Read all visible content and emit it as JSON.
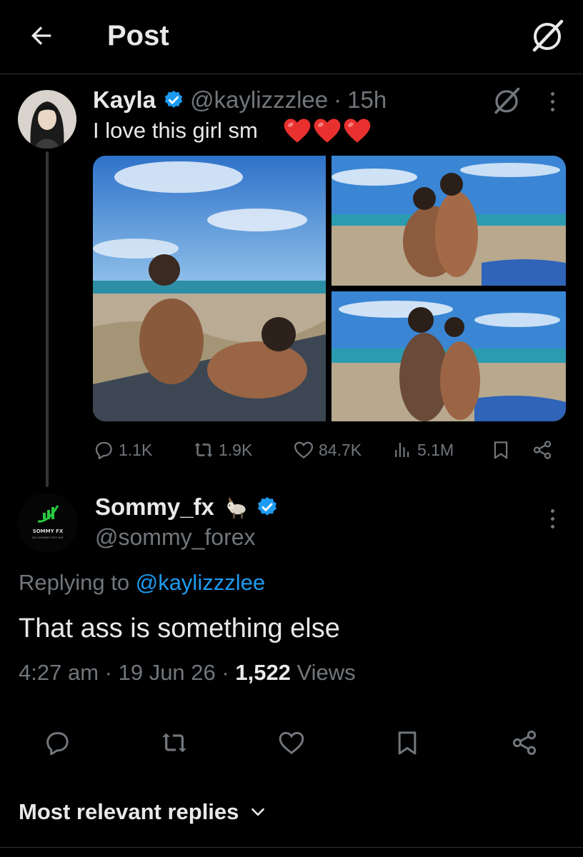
{
  "header": {
    "title": "Post"
  },
  "parent_post": {
    "display_name": "Kayla",
    "handle": "@kaylizzzlee",
    "separator": "·",
    "time": "15h",
    "text": "I love this girl sm",
    "emoji_count": 3,
    "stats": {
      "replies": "1.1K",
      "reposts": "1.9K",
      "likes": "84.7K",
      "views": "5.1M"
    }
  },
  "reply": {
    "display_name": "Sommy_fx",
    "handle": "@sommy_forex",
    "avatar_text": "SOMMY FX",
    "avatar_subtext": "MILLIONAIRES RISE WAY",
    "replying_prefix": "Replying to",
    "replying_mention": "@kaylizzzlee",
    "text": "That ass is something else",
    "time": "4:27 am",
    "date": "19 Jun 26",
    "views_count": "1,522",
    "views_label": "Views",
    "dot": "·"
  },
  "sort": {
    "label": "Most relevant replies"
  },
  "colors": {
    "background": "#000000",
    "primary_text": "#e7e9ea",
    "secondary_text": "#71767b",
    "accent_blue": "#1d9bf0",
    "heart_red": "#e8312f",
    "divider": "#2f3336"
  },
  "icons": {
    "back": "arrow-left-icon",
    "grok": "grok-icon",
    "more": "more-vertical-icon",
    "verified": "verified-badge-icon",
    "reply": "reply-icon",
    "repost": "repost-icon",
    "like": "heart-icon",
    "views": "views-icon",
    "bookmark": "bookmark-icon",
    "share": "share-icon",
    "chevron": "chevron-down-icon"
  }
}
